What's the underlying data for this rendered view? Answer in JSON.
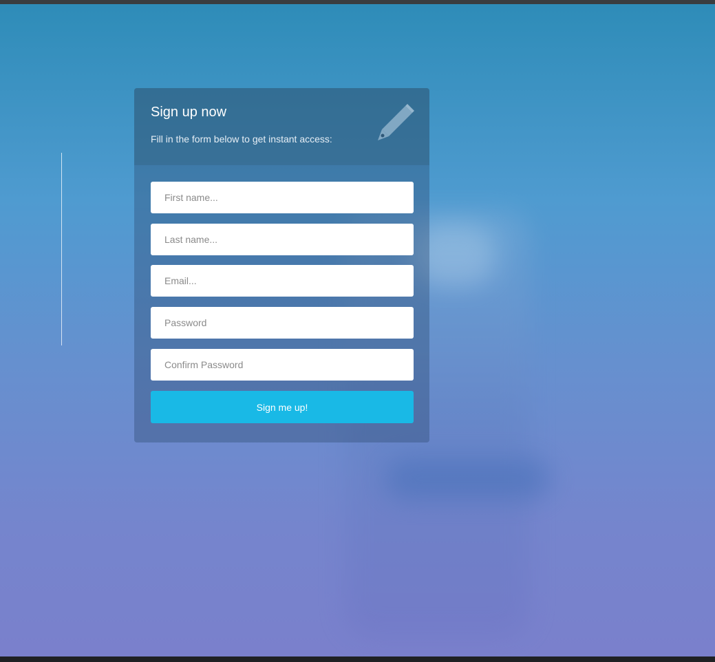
{
  "signup": {
    "title": "Sign up now",
    "subtitle": "Fill in the form below to get instant access:",
    "icon": "pencil-icon",
    "fields": {
      "first_name_placeholder": "First name...",
      "last_name_placeholder": "Last name...",
      "email_placeholder": "Email...",
      "password_placeholder": "Password",
      "confirm_password_placeholder": "Confirm Password"
    },
    "submit_label": "Sign me up!"
  },
  "colors": {
    "accent": "#19b9e6",
    "gradient_top": "#2e8cb8",
    "gradient_bottom": "#7a80cc"
  }
}
